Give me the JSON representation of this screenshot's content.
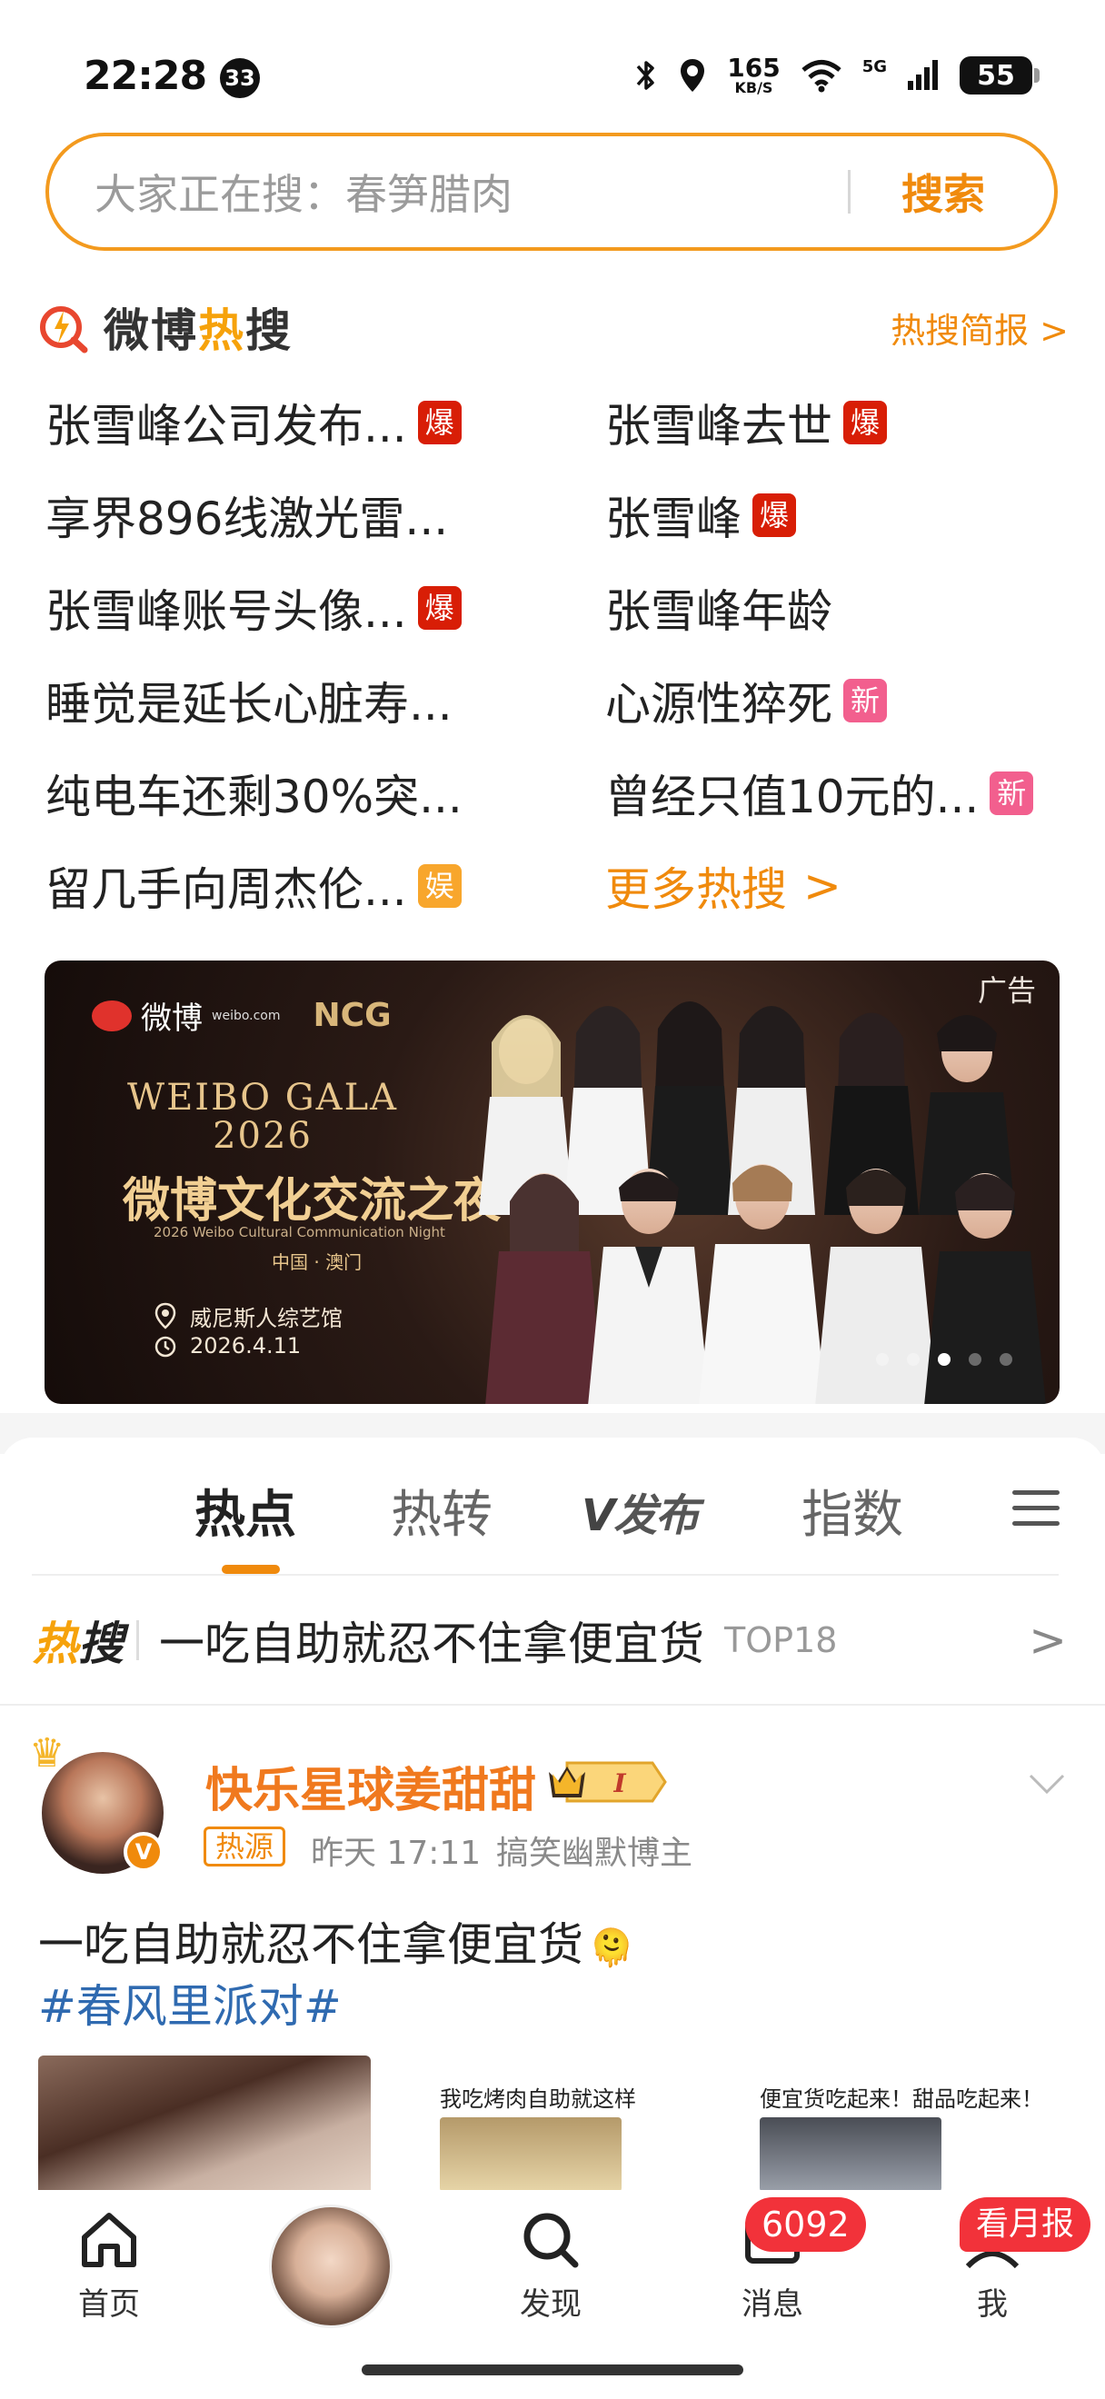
{
  "status_bar": {
    "time": "22:28",
    "notification_count": "33",
    "net_speed_value": "165",
    "net_speed_unit": "KB/S",
    "network_type": "5G",
    "battery": "55"
  },
  "search": {
    "placeholder": "大家正在搜：春笋腊肉",
    "button_label": "搜索"
  },
  "hot_search": {
    "title_prefix": "微博",
    "title_accent": "热",
    "title_suffix": "搜",
    "brief_label": "热搜简报 >",
    "items": [
      {
        "text": "张雪峰公司发布...",
        "tag": "爆",
        "tag_type": "bao"
      },
      {
        "text": "张雪峰去世",
        "tag": "爆",
        "tag_type": "bao"
      },
      {
        "text": "享界896线激光雷...",
        "tag": "",
        "tag_type": ""
      },
      {
        "text": "张雪峰",
        "tag": "爆",
        "tag_type": "bao"
      },
      {
        "text": "张雪峰账号头像...",
        "tag": "爆",
        "tag_type": "bao"
      },
      {
        "text": "张雪峰年龄",
        "tag": "",
        "tag_type": ""
      },
      {
        "text": "睡觉是延长心脏寿...",
        "tag": "",
        "tag_type": ""
      },
      {
        "text": "心源性猝死",
        "tag": "新",
        "tag_type": "xin"
      },
      {
        "text": "纯电车还剩30%突...",
        "tag": "",
        "tag_type": ""
      },
      {
        "text": "曾经只值10元的...",
        "tag": "新",
        "tag_type": "xin"
      },
      {
        "text": "留几手向周杰伦...",
        "tag": "娱",
        "tag_type": "yu"
      }
    ],
    "more_label": "更多热搜",
    "more_arrow": ">"
  },
  "ad": {
    "label": "广告",
    "brand": "微博",
    "brand_site": "weibo.com",
    "partner": "NCG",
    "gala_en_1": "WEIBO GALA",
    "gala_en_2": "2026",
    "gala_cn": "微博文化交流之夜",
    "gala_sub": "2026 Weibo Cultural Communication Night",
    "location_short": "中国 · 澳门",
    "venue": "威尼斯人综艺馆",
    "date": "2026.4.11",
    "active_slide": 3,
    "slide_count": 5
  },
  "feed_tabs": {
    "tabs": [
      "热点",
      "热转",
      "发布",
      "指数"
    ],
    "active": "热点",
    "vfabu_prefix": "V"
  },
  "hot_topic_bar": {
    "logo_text_1": "热",
    "logo_text_2": "搜",
    "text": "一吃自助就忍不住拿便宜货",
    "rank": "TOP18",
    "arrow": ">"
  },
  "post": {
    "username": "快乐星球姜甜甜",
    "vip_level": "I",
    "source_tag": "热源",
    "time": "昨天 17:11",
    "role": "搞笑幽默博主",
    "text": "一吃自助就忍不住拿便宜货",
    "emoji": "🫠",
    "hashtag": "#春风里派对#",
    "thumb_captions": [
      "我吃烤肉自助就这样",
      "便宜货吃起来！甜品吃起来！"
    ]
  },
  "bottom_nav": {
    "items": [
      "首页",
      "发现",
      "消息",
      "我"
    ],
    "message_badge": "6092",
    "me_badge": "看月报"
  },
  "colors": {
    "accent": "#f08a0c",
    "hot_bao": "#d81e06",
    "hot_xin": "#f25f8e",
    "hot_yu": "#f8a62c",
    "badge_red": "#f2323a",
    "link_blue": "#2f6ab0"
  }
}
